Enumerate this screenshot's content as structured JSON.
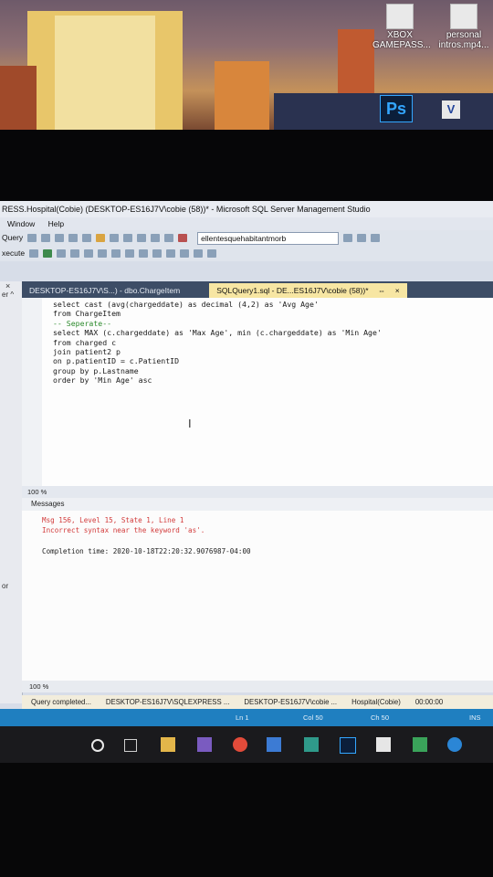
{
  "desktop": {
    "icons": [
      {
        "label": "XBOX\nGAMEPASS..."
      },
      {
        "label": "personal\nintros.mp4..."
      }
    ],
    "ps_badge": "Ps",
    "v_badge": "V"
  },
  "window": {
    "title": "RESS.Hospital(Cobie) (DESKTOP-ES16J7V\\cobie (58))* - Microsoft SQL Server Management Studio",
    "menu": [
      "Window",
      "Help"
    ],
    "toolbar_query_label": "Query",
    "toolbar_execute_label": "xecute",
    "database_selected": "ellentesquehabitantmorb"
  },
  "left_panel": {
    "close": "×",
    "arrow": "er ^",
    "label": "or"
  },
  "tabs": [
    {
      "label": "DESKTOP-ES16J7V\\S...) - dbo.ChargeItem",
      "close": "×"
    },
    {
      "label": "SQLQuery1.sql - DE...ES16J7V\\cobie (58))*",
      "pin": "⇔",
      "close": "×"
    }
  ],
  "editor": {
    "zoom": "100 %",
    "lines": [
      "select cast (avg(chargeddate) as decimal (4,2) as 'Avg Age'",
      "from ChargeItem",
      "-- Seperate--",
      "select MAX (c.chargeddate) as 'Max Age', min (c.chargeddate) as 'Min Age'",
      "from charged c",
      "join patient2 p",
      "on p.patientID = c.PatientID",
      "group by p.Lastname",
      "order by 'Min Age' asc"
    ]
  },
  "results": {
    "tab_label": "Messages",
    "error_line1": "Msg 156, Level 15, State 1, Line 1",
    "error_line2": "Incorrect syntax near the keyword 'as'.",
    "completion": "Completion time: 2020-10-18T22:20:32.9076987-04:00",
    "zoom": "100 %"
  },
  "status": {
    "query_state": "Query completed...",
    "server": "DESKTOP-ES16J7V\\SQLEXPRESS ...",
    "user": "DESKTOP-ES16J7V\\cobie ...",
    "database": "Hospital(Cobie)",
    "time": "00:00:00",
    "ln": "Ln 1",
    "col": "Col 50",
    "ch": "Ch 50",
    "ins": "INS"
  },
  "taskbar": {
    "icons": [
      "search-circle-icon",
      "task-view-icon",
      "file-explorer-icon",
      "photos-icon",
      "chrome-icon",
      "store-icon",
      "linkedin-icon",
      "photoshop-icon",
      "vegas-icon",
      "app-icon",
      "edge-icon"
    ]
  },
  "colors": {
    "keyword": "#1e3fd6",
    "function": "#d04bb0",
    "string": "#c4242e",
    "status_bar": "#1f7fc0",
    "active_tab": "#f7e6a3"
  }
}
